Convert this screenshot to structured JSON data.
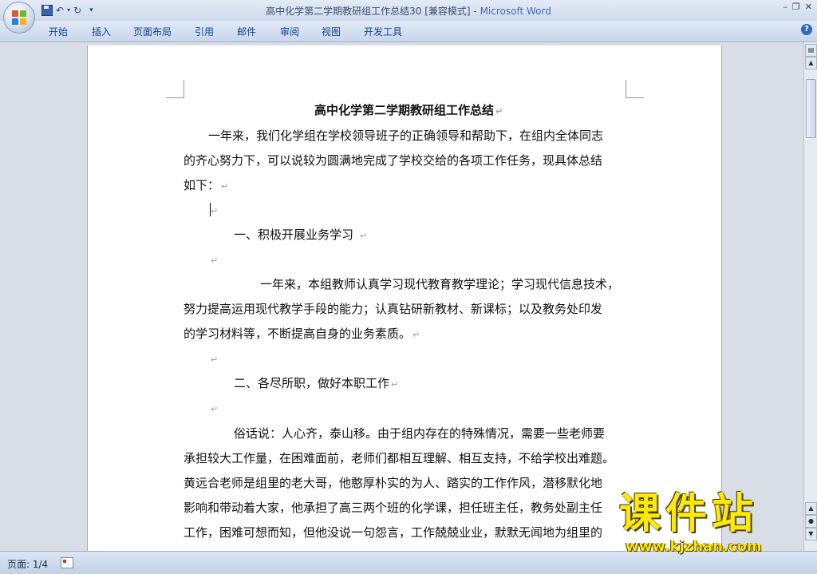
{
  "window": {
    "title": "高中化学第二学期教研组工作总结30 [兼容模式]",
    "title_separator": " - ",
    "app_name": "Microsoft Word",
    "controls": {
      "minimize": "–",
      "restore": "❐",
      "close": "✕"
    }
  },
  "quick_access": {
    "undo": "↶",
    "redo": "↻",
    "customize": "▾"
  },
  "ribbon": {
    "tabs": [
      "开始",
      "插入",
      "页面布局",
      "引用",
      "邮件",
      "审阅",
      "视图",
      "开发工具"
    ],
    "help": "?"
  },
  "document": {
    "title": "高中化学第二学期教研组工作总结",
    "paragraph_mark": "↵",
    "lines": [
      "一年来，我们化学组在学校领导班子的正确领导和帮助下，在组内全体同志",
      "的齐心努力下，可以说较为圆满地完成了学校交给的各项工作任务，现具体总结",
      "如下：",
      "",
      "一、积极开展业务学习",
      "",
      "一年来，本组教师认真学习现代教育教学理论；学习现代信息技术，",
      "努力提高运用现代教学手段的能力；认真钻研新教材、新课标；以及教务处印发",
      "的学习材料等，不断提高自身的业务素质。",
      "",
      "二、各尽所职，做好本职工作",
      "",
      "俗话说：人心齐，泰山移。由于组内存在的特殊情况，需要一些老师要",
      "承担较大工作量，在困难面前，老师们都相互理解、相互支持，不给学校出难题。",
      "黄远合老师是组里的老大哥，他憨厚朴实的为人、踏实的工作作风，潜移默化地",
      "影响和带动着大家，他承担了高三两个班的化学课，担任班主任，教务处副主任",
      "工作，困难可想而知，但他没说一句怨言，工作兢兢业业，默默无闻地为组里的"
    ]
  },
  "statusbar": {
    "page": "页面: 1/4"
  },
  "watermark": {
    "title": "课件站",
    "url": "www.kjzhan.com"
  },
  "colors": {
    "accent": "#3f6fb5",
    "watermark": "#ffea00"
  }
}
